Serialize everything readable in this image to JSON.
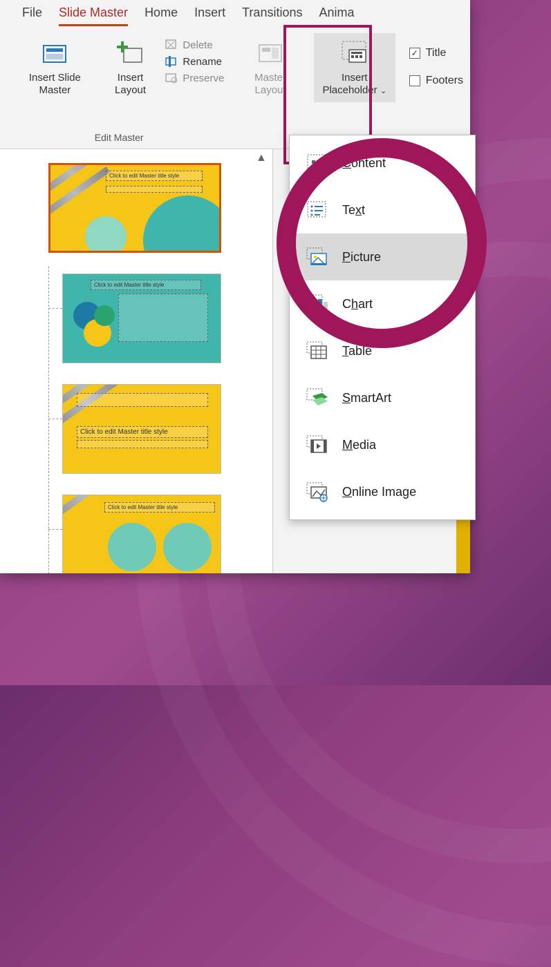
{
  "tabs": {
    "file": "File",
    "slide_master": "Slide Master",
    "home": "Home",
    "insert": "Insert",
    "transitions": "Transitions",
    "animations": "Anima"
  },
  "ribbon": {
    "insert_slide_master": "Insert Slide Master",
    "insert_layout": "Insert Layout",
    "delete": "Delete",
    "rename": "Rename",
    "preserve": "Preserve",
    "group_edit_master": "Edit Master",
    "master_layout": "Master Layout",
    "insert_placeholder": "Insert Placeholder",
    "title_check": "Title",
    "footers_check": "Footers"
  },
  "menu": {
    "content": "Content",
    "text": "Text",
    "picture": "Picture",
    "chart": "Chart",
    "table": "Table",
    "smartart": "SmartArt",
    "media": "Media",
    "online_image": "Online Image"
  },
  "thumbs": {
    "master_title": "Click to edit Master title style",
    "layout_title": "Click to edit Master title style"
  }
}
